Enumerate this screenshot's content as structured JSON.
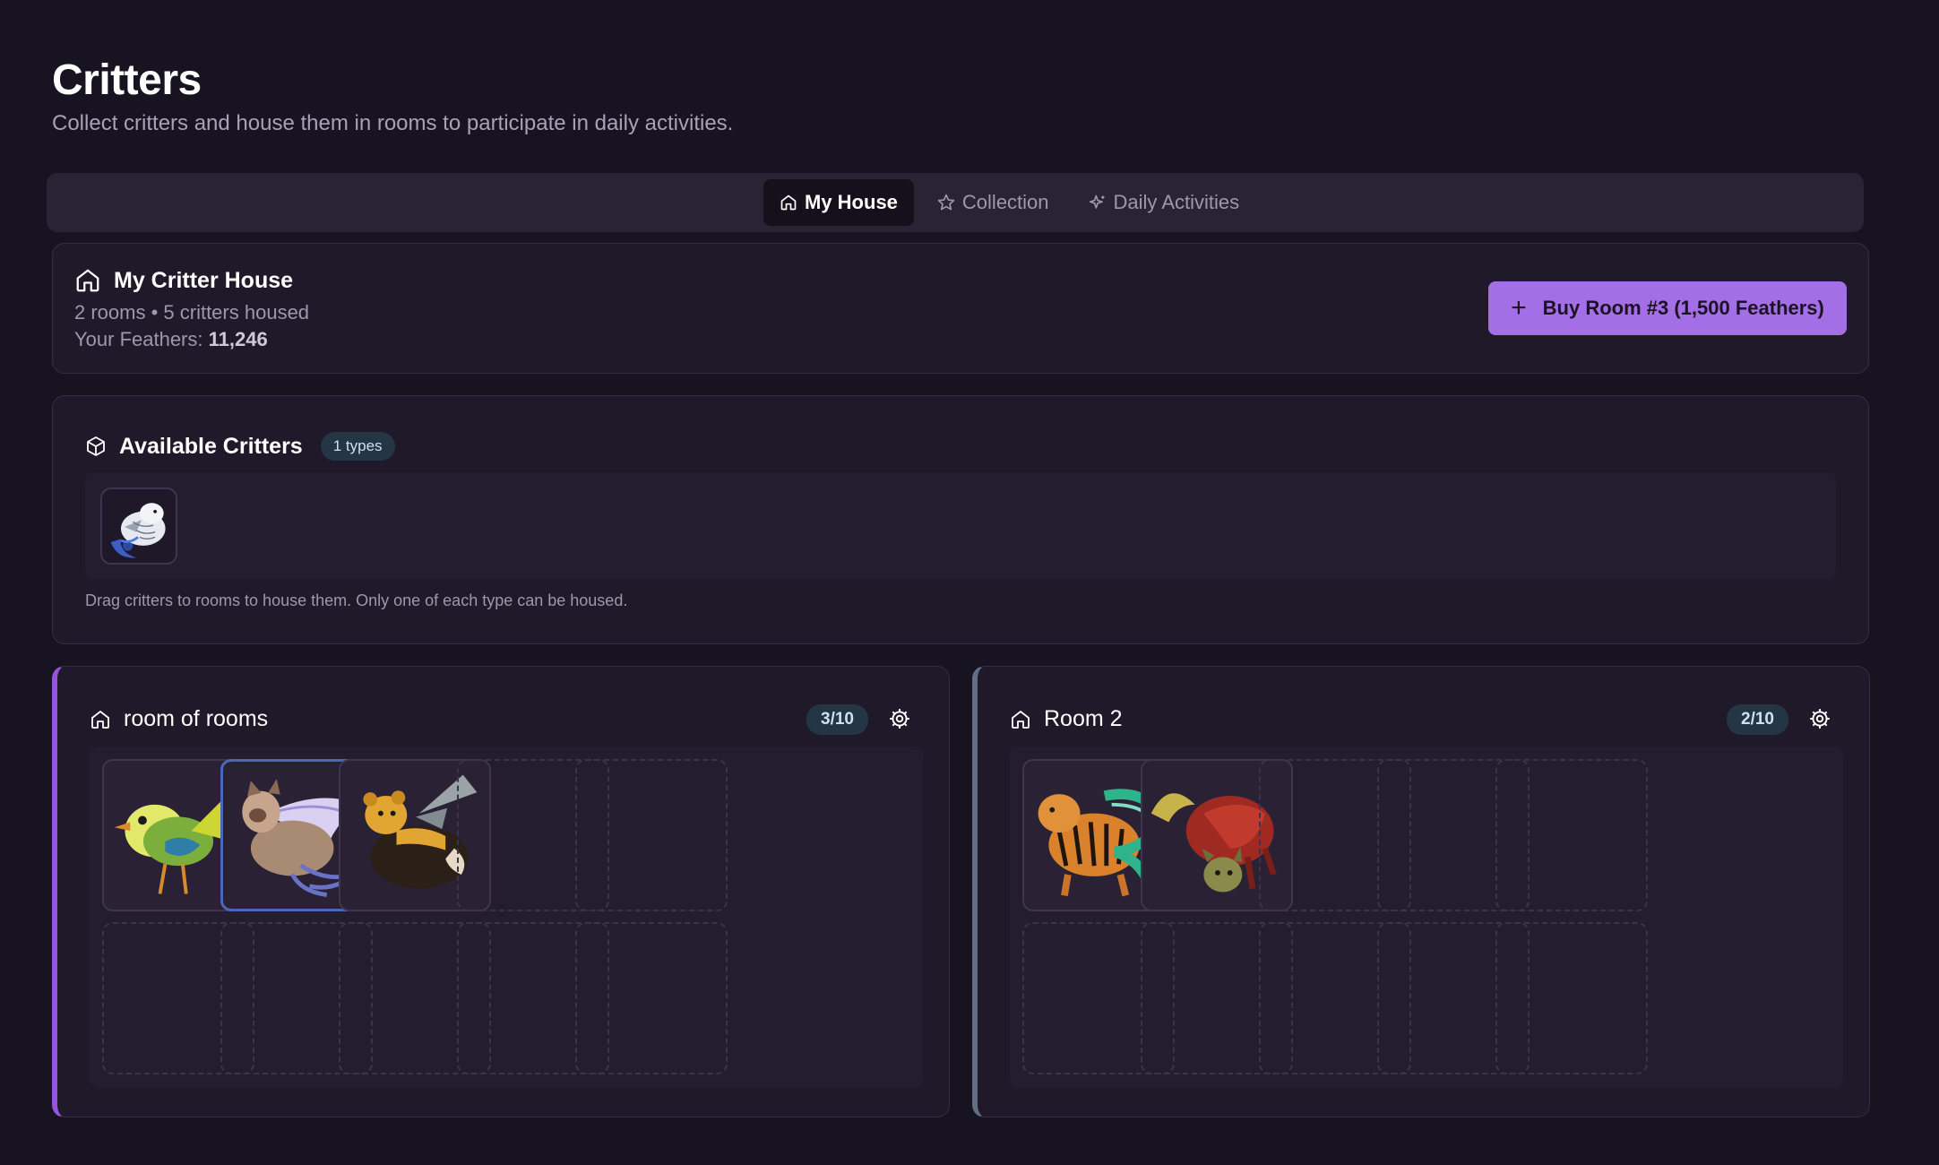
{
  "header": {
    "title": "Critters",
    "subtitle": "Collect critters and house them in rooms to participate in daily activities."
  },
  "tabs": [
    {
      "label": "My House",
      "icon": "home-icon",
      "active": true
    },
    {
      "label": "Collection",
      "icon": "star-icon",
      "active": false
    },
    {
      "label": "Daily Activities",
      "icon": "sparkles-icon",
      "active": false
    }
  ],
  "house": {
    "title": "My Critter House",
    "summary": "2 rooms • 5 critters housed",
    "feathers_label": "Your Feathers:",
    "feathers_value": "11,246",
    "buy_button": "Buy Room #3 (1,500 Feathers)"
  },
  "available": {
    "title": "Available Critters",
    "badge": "1 types",
    "critters": [
      {
        "icon": "snowy-owl-critter-icon"
      }
    ],
    "hint": "Drag critters to rooms to house them. Only one of each type can be housed."
  },
  "rooms": [
    {
      "name": "room of rooms",
      "count": "3/10",
      "accent": "#9553e0",
      "slots": [
        "green-bird-critter",
        "winged-cat-critter",
        "bee-bear-critter",
        null,
        null,
        null,
        null,
        null,
        null,
        null
      ]
    },
    {
      "name": "Room 2",
      "count": "2/10",
      "accent": "#5e6f86",
      "slots": [
        "tiger-critter",
        "red-fox-critter",
        null,
        null,
        null,
        null,
        null,
        null,
        null,
        null
      ]
    }
  ],
  "colors": {
    "background": "#181320",
    "accent_purple": "#a36ee6",
    "badge_bg": "#243545"
  }
}
